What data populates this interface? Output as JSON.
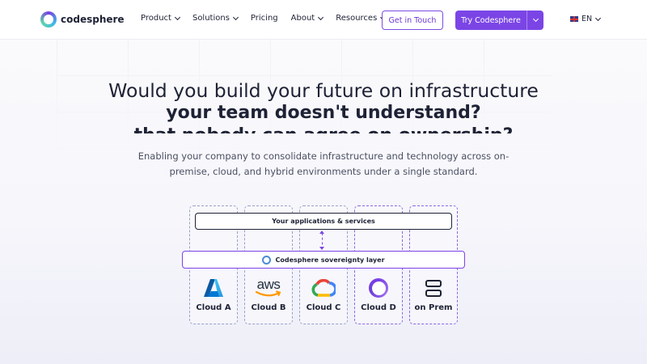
{
  "nav": {
    "brand": "codesphere",
    "menu": [
      {
        "label": "Product",
        "dropdown": true
      },
      {
        "label": "Solutions",
        "dropdown": true
      },
      {
        "label": "Pricing",
        "dropdown": false
      },
      {
        "label": "About",
        "dropdown": true
      },
      {
        "label": "Resources",
        "dropdown": true
      }
    ],
    "get_in_touch": "Get in Touch",
    "try_label": "Try Codesphere",
    "language": "EN"
  },
  "hero": {
    "line1": "Would you build your future on infrastructure",
    "line2": "your team doesn't understand?",
    "line3": "that nobody can agree on ownership?",
    "subtitle": "Enabling your company to consolidate infrastructure and technology across on-premise, cloud, and hybrid environments under a single standard."
  },
  "diagram": {
    "apps_layer": "Your applications & services",
    "sovereignty_layer": "Codesphere sovereignty layer",
    "aws_text": "aws",
    "clouds": [
      {
        "label": "Cloud A",
        "icon": "azure-icon"
      },
      {
        "label": "Cloud B",
        "icon": "aws-icon"
      },
      {
        "label": "Cloud C",
        "icon": "google-cloud-icon"
      },
      {
        "label": "Cloud D",
        "icon": "codesphere-icon"
      },
      {
        "label": "on Prem",
        "icon": "server-icon"
      }
    ]
  },
  "colors": {
    "accent": "#7b45e6",
    "text": "#1e2235",
    "border_dashed": "#9aa0c8"
  }
}
